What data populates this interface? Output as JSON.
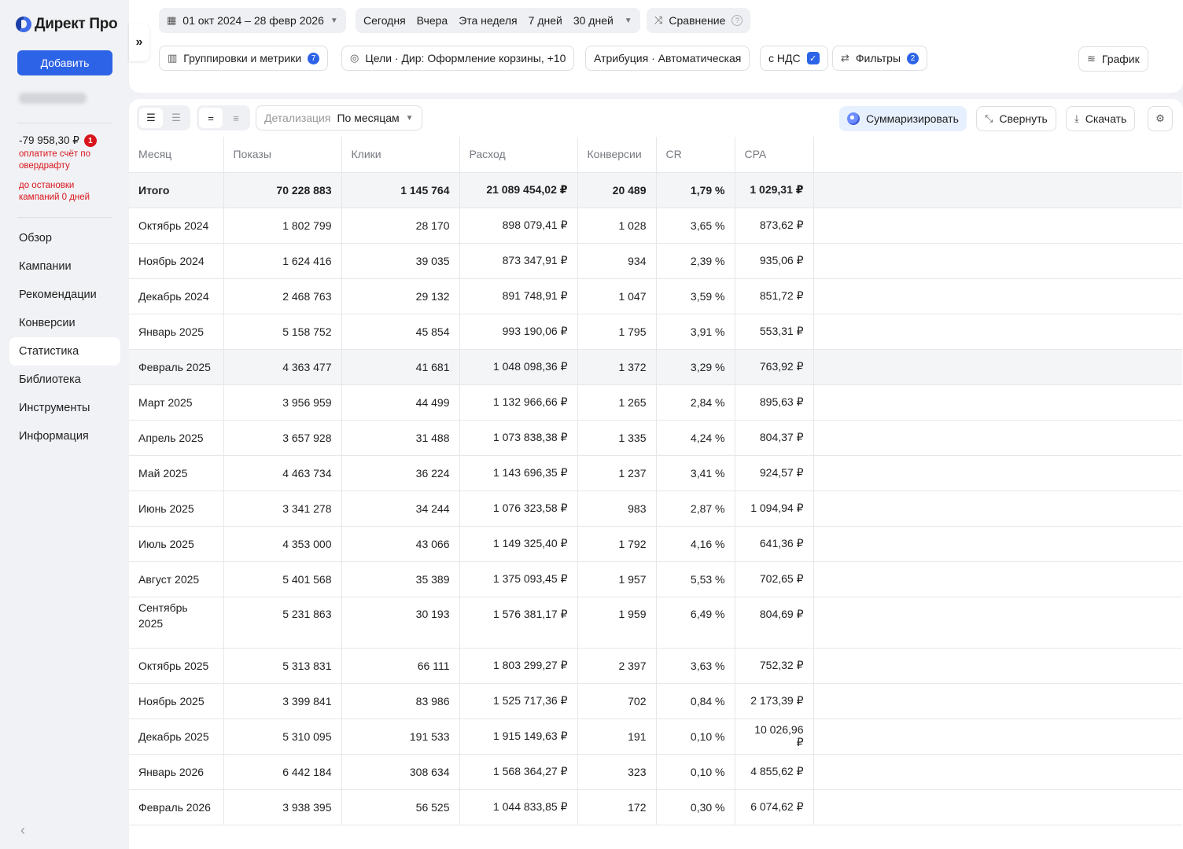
{
  "app": {
    "name": "Директ Про"
  },
  "sidebar": {
    "add_label": "Добавить",
    "balance": "-79 958,30 ₽",
    "balance_badge": "1",
    "warning1": "оплатите счёт по овердрафту",
    "warning2": "до остановки кампаний 0 дней",
    "items": [
      {
        "label": "Обзор"
      },
      {
        "label": "Кампании"
      },
      {
        "label": "Рекомендации"
      },
      {
        "label": "Конверсии"
      },
      {
        "label": "Статистика"
      },
      {
        "label": "Библиотека"
      },
      {
        "label": "Инструменты"
      },
      {
        "label": "Информация"
      }
    ],
    "active_index": 4
  },
  "filters": {
    "date_range": "01 окт 2024 – 28 февр 2026",
    "presets": [
      "Сегодня",
      "Вчера",
      "Эта неделя",
      "7 дней",
      "30 дней"
    ],
    "compare": "Сравнение",
    "groupings": "Группировки и метрики",
    "groupings_count": "7",
    "goals": "Цели · Дир: Оформление корзины, +10",
    "attribution": "Атрибуция · Автоматическая",
    "vat": "с НДС",
    "filters_label": "Фильтры",
    "filters_count": "2",
    "chart": "График"
  },
  "toolbar": {
    "detail_label": "Детализация",
    "detail_value": "По месяцам",
    "summarize": "Суммаризировать",
    "collapse": "Свернуть",
    "download": "Скачать"
  },
  "table": {
    "headers": [
      "Месяц",
      "Показы",
      "Клики",
      "Расход",
      "Конверсии",
      "CR",
      "CPA"
    ],
    "total": [
      "Итого",
      "70 228 883",
      "1 145 764",
      "21 089 454,02 ₽",
      "20 489",
      "1,79 %",
      "1 029,31 ₽"
    ],
    "rows": [
      [
        "Октябрь 2024",
        "1 802 799",
        "28 170",
        "898 079,41 ₽",
        "1 028",
        "3,65 %",
        "873,62 ₽"
      ],
      [
        "Ноябрь 2024",
        "1 624 416",
        "39 035",
        "873 347,91 ₽",
        "934",
        "2,39 %",
        "935,06 ₽"
      ],
      [
        "Декабрь 2024",
        "2 468 763",
        "29 132",
        "891 748,91 ₽",
        "1 047",
        "3,59 %",
        "851,72 ₽"
      ],
      [
        "Январь 2025",
        "5 158 752",
        "45 854",
        "993 190,06 ₽",
        "1 795",
        "3,91 %",
        "553,31 ₽"
      ],
      [
        "Февраль 2025",
        "4 363 477",
        "41 681",
        "1 048 098,36 ₽",
        "1 372",
        "3,29 %",
        "763,92 ₽"
      ],
      [
        "Март 2025",
        "3 956 959",
        "44 499",
        "1 132 966,66 ₽",
        "1 265",
        "2,84 %",
        "895,63 ₽"
      ],
      [
        "Апрель 2025",
        "3 657 928",
        "31 488",
        "1 073 838,38 ₽",
        "1 335",
        "4,24 %",
        "804,37 ₽"
      ],
      [
        "Май 2025",
        "4 463 734",
        "36 224",
        "1 143 696,35 ₽",
        "1 237",
        "3,41 %",
        "924,57 ₽"
      ],
      [
        "Июнь 2025",
        "3 341 278",
        "34 244",
        "1 076 323,58 ₽",
        "983",
        "2,87 %",
        "1 094,94 ₽"
      ],
      [
        "Июль 2025",
        "4 353 000",
        "43 066",
        "1 149 325,40 ₽",
        "1 792",
        "4,16 %",
        "641,36 ₽"
      ],
      [
        "Август 2025",
        "5 401 568",
        "35 389",
        "1 375 093,45 ₽",
        "1 957",
        "5,53 %",
        "702,65 ₽"
      ],
      [
        "Сентябрь 2025",
        "5 231 863",
        "30 193",
        "1 576 381,17 ₽",
        "1 959",
        "6,49 %",
        "804,69 ₽"
      ],
      [
        "Октябрь 2025",
        "5 313 831",
        "66 111",
        "1 803 299,27 ₽",
        "2 397",
        "3,63 %",
        "752,32 ₽"
      ],
      [
        "Ноябрь 2025",
        "3 399 841",
        "83 986",
        "1 525 717,36 ₽",
        "702",
        "0,84 %",
        "2 173,39 ₽"
      ],
      [
        "Декабрь 2025",
        "5 310 095",
        "191 533",
        "1 915 149,63 ₽",
        "191",
        "0,10 %",
        "10 026,96 ₽"
      ],
      [
        "Январь 2026",
        "6 442 184",
        "308 634",
        "1 568 364,27 ₽",
        "323",
        "0,10 %",
        "4 855,62 ₽"
      ],
      [
        "Февраль 2026",
        "3 938 395",
        "56 525",
        "1 044 833,85 ₽",
        "172",
        "0,30 %",
        "6 074,62 ₽"
      ]
    ],
    "highlighted_row": 4,
    "tall_row": 11
  }
}
